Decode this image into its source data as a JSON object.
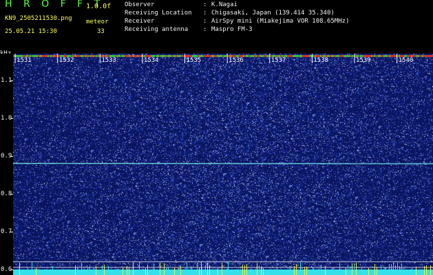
{
  "header": {
    "app_title": "H R O F F T",
    "version": "1.0.0f",
    "file_name": "KN9_2505211530.png",
    "meteor_label": "meteor",
    "date_time": "25.05.21 15:30",
    "meteor_count": "33"
  },
  "info": [
    {
      "key": "Observer",
      "colon": ":",
      "value": "K.Nagai"
    },
    {
      "key": "Receiving Location",
      "colon": ":",
      "value": "Chigasaki, Japan (139.414 35.340)"
    },
    {
      "key": "Receiver",
      "colon": ":",
      "value": "AirSpy mini (Miakejima VOR 108.65MHz)"
    },
    {
      "key": "Receiving antenna",
      "colon": ":",
      "value": "Maspro FM-3"
    }
  ],
  "chart_data": {
    "type": "heatmap",
    "y_unit_label": "kHz",
    "y_ticks": [
      "1.1",
      "1.0",
      "0.9",
      "0.8",
      "0.7",
      "0.6"
    ],
    "y_tick_values": [
      1.1,
      1.0,
      0.9,
      0.8,
      0.7,
      0.6
    ],
    "ylim": [
      0.585,
      1.17
    ],
    "x_ticks": [
      "1531",
      "1532",
      "1533",
      "1534",
      "1535",
      "1536",
      "1537",
      "1538",
      "1539",
      "1540"
    ],
    "x_tick_values": [
      1531,
      1532,
      1533,
      1534,
      1535,
      1536,
      1537,
      1538,
      1539,
      1540
    ],
    "xlim": [
      1530.95,
      1540.85
    ],
    "carrier_line_khz": 0.88,
    "reference_lines_khz": [
      0.62,
      0.605
    ],
    "colors": {
      "background": "#0a1560",
      "noise_low": "#3048c8",
      "noise_high": "#c8d8ff",
      "carrier": "#7cf0e8",
      "baseline": "#34e0ea",
      "spike": "#e8f040",
      "tick_band_red": "#d03030",
      "tick_band_green": "#30c040"
    }
  }
}
